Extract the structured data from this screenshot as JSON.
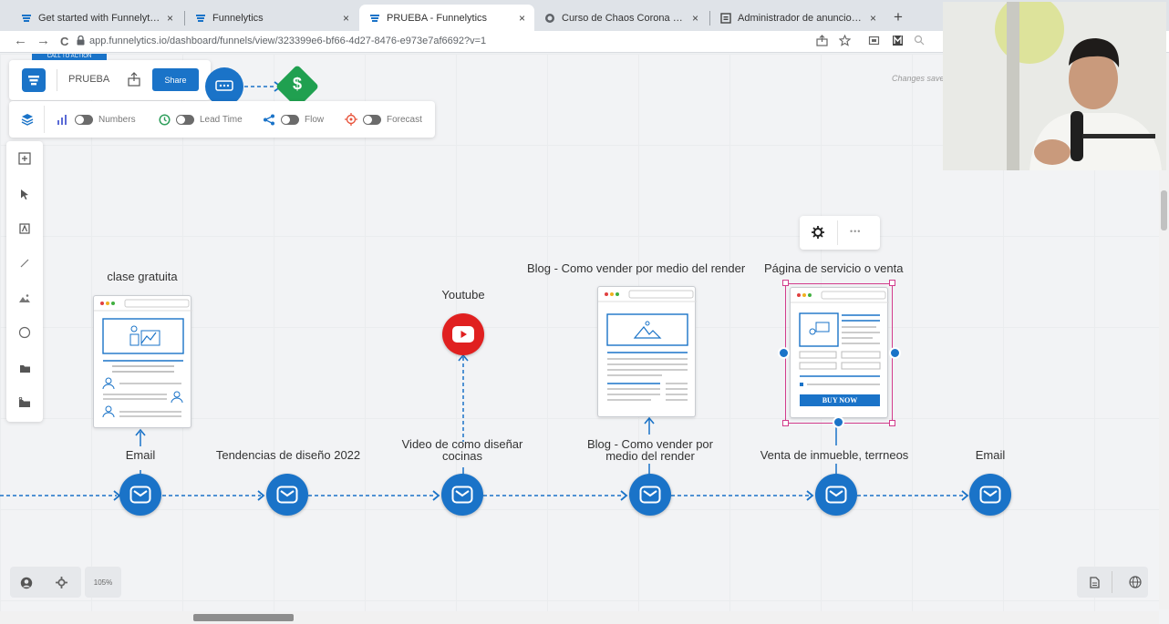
{
  "browser": {
    "tabs": [
      {
        "title": "Get started with Funnelytics™",
        "active": false
      },
      {
        "title": "Funnelytics",
        "active": false
      },
      {
        "title": "PRUEBA - Funnelytics",
        "active": true
      },
      {
        "title": "Curso de Chaos Corona render de",
        "active": false
      },
      {
        "title": "Administrador de anuncios - Adr",
        "active": false
      }
    ],
    "close_glyph": "×",
    "new_tab_glyph": "+",
    "url": "app.funnelytics.io/dashboard/funnels/view/323399e6-bf66-4d27-8476-e973e7af6692?v=1",
    "nav": {
      "back": "←",
      "forward": "→",
      "reload": "C"
    }
  },
  "toolbar": {
    "funnel_name": "PRUEBA",
    "share_label": "Share",
    "call_to_action_label": "CALL TO ACTION",
    "changes_saved": "Changes save"
  },
  "toggles": [
    {
      "label": "Numbers",
      "icon": "bar-chart-icon",
      "color": "#5b6bd6"
    },
    {
      "label": "Lead Time",
      "icon": "clock-icon",
      "color": "#2e9e5b"
    },
    {
      "label": "Flow",
      "icon": "share-icon",
      "color": "#1a73c8"
    },
    {
      "label": "Forecast",
      "icon": "target-icon",
      "color": "#e8553d"
    }
  ],
  "tools": [
    "plus-square-icon",
    "pointer-icon",
    "text-box-icon",
    "line-icon",
    "image-icon",
    "circle-icon",
    "folder-icon",
    "folder-settings-icon"
  ],
  "nodes": {
    "clase": "clase gratuita",
    "youtube": "Youtube",
    "blog_top": "Blog - Como vender por medio del render",
    "venta_top": "Página de servicio o venta",
    "buy_now": "BUY NOW",
    "emails": [
      {
        "label": "Email"
      },
      {
        "label": "Tendencias de diseño 2022"
      },
      {
        "label": "Video de como diseñar cocinas"
      },
      {
        "label": "Blog - Como vender por medio del render"
      },
      {
        "label": "Venta de inmueble, terrneos"
      },
      {
        "label": "Email"
      }
    ]
  },
  "node_menu": {
    "more_glyph": "•••"
  },
  "bottom": {
    "zoom": "105%"
  },
  "colors": {
    "primary": "#1a73c8",
    "youtube": "#e02020",
    "money": "#20a050",
    "selection": "#d23c8c"
  }
}
